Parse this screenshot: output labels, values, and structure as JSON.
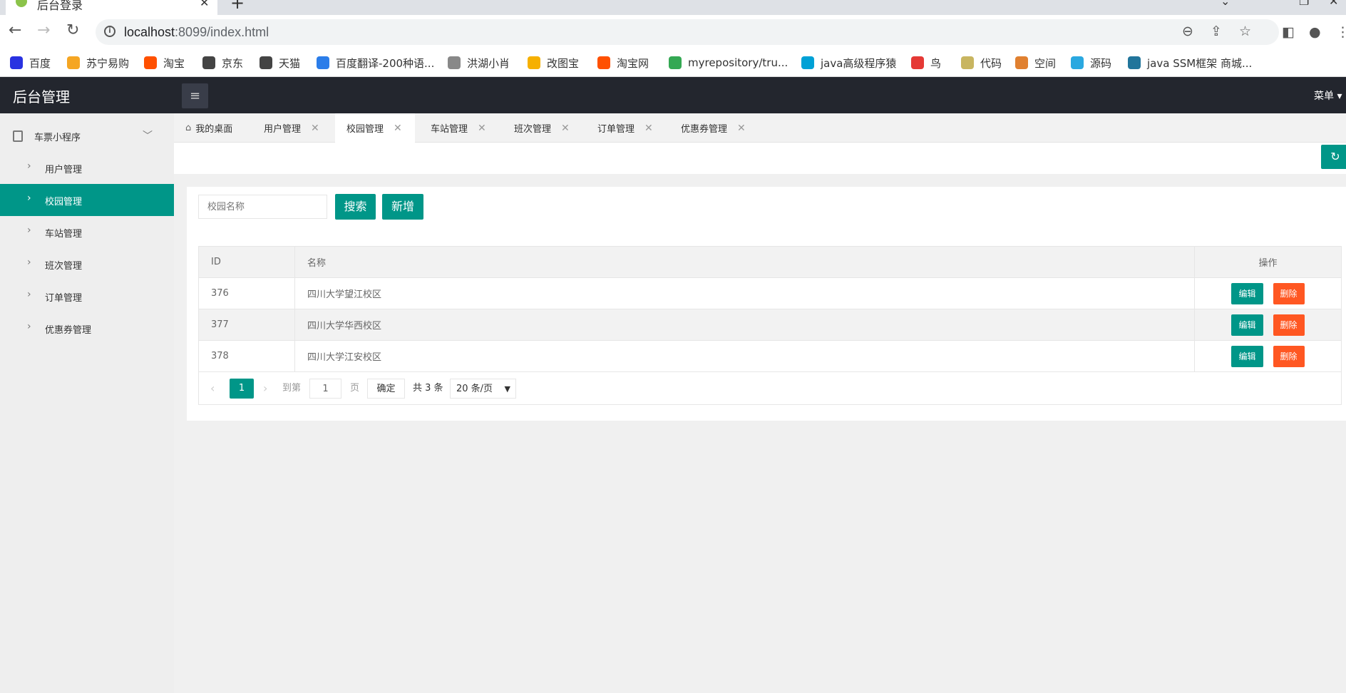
{
  "browser": {
    "tab_title": "后台登录",
    "url_host": "localhost",
    "url_rest": ":8099/index.html",
    "bookmarks": [
      {
        "label": "百度",
        "color": "#2932e1"
      },
      {
        "label": "苏宁易购",
        "color": "#f5a623"
      },
      {
        "label": "淘宝",
        "color": "#ff5000"
      },
      {
        "label": "京东",
        "color": "#444444"
      },
      {
        "label": "天猫",
        "color": "#444444"
      },
      {
        "label": "百度翻译-200种语...",
        "color": "#2b7de9"
      },
      {
        "label": "洪湖小肖",
        "color": "#888888"
      },
      {
        "label": "改图宝",
        "color": "#f6b000"
      },
      {
        "label": "淘宝网",
        "color": "#ff5000"
      },
      {
        "label": "myrepository/tru...",
        "color": "#34a853"
      },
      {
        "label": "java高级程序猿",
        "color": "#00a1d6"
      },
      {
        "label": "鸟",
        "color": "#e53935"
      },
      {
        "label": "代码",
        "color": "#c8b560"
      },
      {
        "label": "空间",
        "color": "#e08030"
      },
      {
        "label": "源码",
        "color": "#2aa8e0"
      },
      {
        "label": "java SSM框架 商城...",
        "color": "#21759b"
      }
    ]
  },
  "app": {
    "title": "后台管理",
    "menu_label": "菜单",
    "accent": "#009688",
    "danger": "#ff5722"
  },
  "sidebar": {
    "parent": "车票小程序",
    "items": [
      "用户管理",
      "校园管理",
      "车站管理",
      "班次管理",
      "订单管理",
      "优惠券管理"
    ],
    "active_index": 1
  },
  "tabs": [
    "我的桌面",
    "用户管理",
    "校园管理",
    "车站管理",
    "班次管理",
    "订单管理",
    "优惠券管理"
  ],
  "search": {
    "placeholder": "校园名称",
    "search_label": "搜索",
    "add_label": "新增"
  },
  "table": {
    "headers": [
      "ID",
      "名称",
      "操作"
    ],
    "rows": [
      {
        "id": "376",
        "name": "四川大学望江校区"
      },
      {
        "id": "377",
        "name": "四川大学华西校区"
      },
      {
        "id": "378",
        "name": "四川大学江安校区"
      }
    ],
    "edit_label": "编辑",
    "delete_label": "删除"
  },
  "pager": {
    "current": "1",
    "goto_label": "到第",
    "goto_value": "1",
    "page_label": "页",
    "confirm_label": "确定",
    "total_label": "共 3 条",
    "per_page": "20 条/页"
  }
}
